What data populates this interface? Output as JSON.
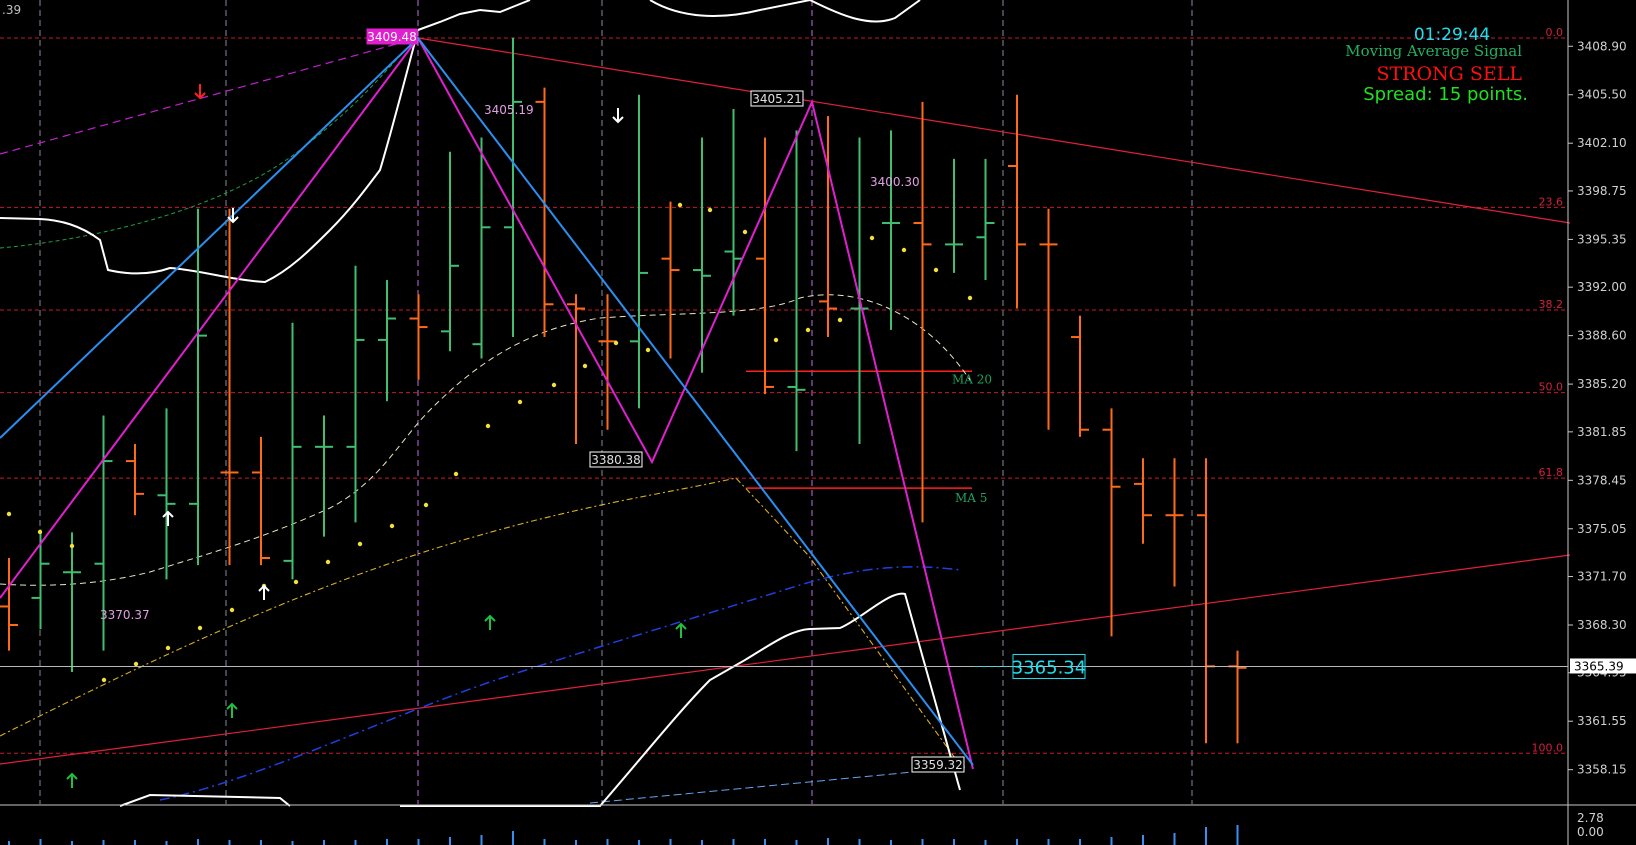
{
  "chart_data": {
    "type": "ohlc",
    "corner_label": ".39",
    "clock": "01:29:44",
    "signal_title": "Moving Average Signal",
    "signal_value": "STRONG SELL",
    "spread_text": "Spread: 15 points.",
    "current_price_tag": "3365.34",
    "axis_price_tag": "3365.39",
    "grid": true,
    "ylim": [
      3356.5,
      3412.0
    ],
    "y_ticks": [
      "3408.90",
      "3405.50",
      "3402.10",
      "3398.75",
      "3395.35",
      "3392.00",
      "3388.60",
      "3385.20",
      "3381.85",
      "3378.45",
      "3375.05",
      "3371.70",
      "3368.30",
      "3364.95",
      "3361.55",
      "3358.15"
    ],
    "fib_levels": [
      {
        "label": "0.0",
        "price": 3409.48
      },
      {
        "label": "23.6",
        "price": 3397.6
      },
      {
        "label": "38.2",
        "price": 3390.4
      },
      {
        "label": "50.0",
        "price": 3384.6
      },
      {
        "label": "61.8",
        "price": 3378.6
      },
      {
        "label": "100.0",
        "price": 3359.3
      }
    ],
    "price_labels": [
      "3409.48",
      "3405.19",
      "3405.21",
      "3400.30",
      "3380.38",
      "3370.37",
      "3359.32"
    ],
    "ma_labels": [
      "MA 20",
      "MA 5"
    ],
    "bars": [
      {
        "o": 3369.6,
        "h": 3373.0,
        "l": 3366.5,
        "c": 3368.3,
        "dir": "down"
      },
      {
        "o": 3370.2,
        "h": 3375.0,
        "l": 3368.0,
        "c": 3372.6,
        "dir": "up"
      },
      {
        "o": 3372.0,
        "h": 3374.8,
        "l": 3365.0,
        "c": 3372.0,
        "dir": "up"
      },
      {
        "o": 3372.6,
        "h": 3383.0,
        "l": 3366.5,
        "c": 3379.8,
        "dir": "up"
      },
      {
        "o": 3379.8,
        "h": 3381.0,
        "l": 3376.0,
        "c": 3377.5,
        "dir": "down"
      },
      {
        "o": 3377.4,
        "h": 3383.5,
        "l": 3371.5,
        "c": 3376.8,
        "dir": "up"
      },
      {
        "o": 3376.8,
        "h": 3397.5,
        "l": 3372.5,
        "c": 3388.6,
        "dir": "up"
      },
      {
        "o": 3379.0,
        "h": 3397.5,
        "l": 3372.5,
        "c": 3379.0,
        "dir": "down"
      },
      {
        "o": 3379.0,
        "h": 3381.5,
        "l": 3372.5,
        "c": 3373.0,
        "dir": "down"
      },
      {
        "o": 3372.8,
        "h": 3389.5,
        "l": 3371.5,
        "c": 3380.8,
        "dir": "up"
      },
      {
        "o": 3380.8,
        "h": 3383.0,
        "l": 3374.5,
        "c": 3380.8,
        "dir": "up"
      },
      {
        "o": 3380.8,
        "h": 3393.5,
        "l": 3375.5,
        "c": 3388.3,
        "dir": "up"
      },
      {
        "o": 3388.3,
        "h": 3392.5,
        "l": 3384.0,
        "c": 3389.8,
        "dir": "up"
      },
      {
        "o": 3389.8,
        "h": 3391.5,
        "l": 3385.5,
        "c": 3389.2,
        "dir": "down"
      },
      {
        "o": 3388.9,
        "h": 3401.5,
        "l": 3387.5,
        "c": 3393.5,
        "dir": "up"
      },
      {
        "o": 3388.0,
        "h": 3402.5,
        "l": 3387.0,
        "c": 3396.2,
        "dir": "up"
      },
      {
        "o": 3396.2,
        "h": 3409.5,
        "l": 3388.5,
        "c": 3405.0,
        "dir": "up"
      },
      {
        "o": 3405.0,
        "h": 3406.0,
        "l": 3388.5,
        "c": 3390.8,
        "dir": "down"
      },
      {
        "o": 3390.8,
        "h": 3391.5,
        "l": 3381.0,
        "c": 3390.5,
        "dir": "down"
      },
      {
        "o": 3388.2,
        "h": 3391.5,
        "l": 3382.0,
        "c": 3388.2,
        "dir": "down"
      },
      {
        "o": 3388.2,
        "h": 3405.5,
        "l": 3383.5,
        "c": 3393.0,
        "dir": "up"
      },
      {
        "o": 3394.0,
        "h": 3398.0,
        "l": 3387.0,
        "c": 3393.2,
        "dir": "down"
      },
      {
        "o": 3393.2,
        "h": 3402.5,
        "l": 3386.0,
        "c": 3392.8,
        "dir": "up"
      },
      {
        "o": 3394.5,
        "h": 3404.5,
        "l": 3390.0,
        "c": 3394.0,
        "dir": "up"
      },
      {
        "o": 3394.0,
        "h": 3402.5,
        "l": 3384.5,
        "c": 3385.0,
        "dir": "down"
      },
      {
        "o": 3385.0,
        "h": 3403.0,
        "l": 3380.5,
        "c": 3384.8,
        "dir": "up"
      },
      {
        "o": 3391.0,
        "h": 3404.0,
        "l": 3388.5,
        "c": 3390.5,
        "dir": "down"
      },
      {
        "o": 3390.5,
        "h": 3402.5,
        "l": 3381.0,
        "c": 3390.5,
        "dir": "up"
      },
      {
        "o": 3396.5,
        "h": 3403.0,
        "l": 3389.0,
        "c": 3396.5,
        "dir": "up"
      },
      {
        "o": 3396.5,
        "h": 3405.0,
        "l": 3375.5,
        "c": 3395.0,
        "dir": "down"
      },
      {
        "o": 3395.0,
        "h": 3401.0,
        "l": 3393.0,
        "c": 3395.0,
        "dir": "up"
      },
      {
        "o": 3395.5,
        "h": 3401.0,
        "l": 3392.5,
        "c": 3396.5,
        "dir": "up"
      },
      {
        "o": 3400.5,
        "h": 3405.5,
        "l": 3390.5,
        "c": 3395.0,
        "dir": "down"
      },
      {
        "o": 3395.0,
        "h": 3397.5,
        "l": 3382.0,
        "c": 3395.0,
        "dir": "down"
      },
      {
        "o": 3388.5,
        "h": 3390.0,
        "l": 3381.5,
        "c": 3382.0,
        "dir": "down"
      },
      {
        "o": 3382.0,
        "h": 3383.5,
        "l": 3367.5,
        "c": 3378.0,
        "dir": "down"
      },
      {
        "o": 3378.2,
        "h": 3380.0,
        "l": 3374.0,
        "c": 3376.0,
        "dir": "down"
      },
      {
        "o": 3376.0,
        "h": 3380.0,
        "l": 3371.0,
        "c": 3376.0,
        "dir": "down"
      },
      {
        "o": 3376.0,
        "h": 3380.0,
        "l": 3360.0,
        "c": 3365.4,
        "dir": "down"
      },
      {
        "o": 3365.4,
        "h": 3366.5,
        "l": 3360.0,
        "c": 3365.3,
        "dir": "down"
      }
    ]
  }
}
